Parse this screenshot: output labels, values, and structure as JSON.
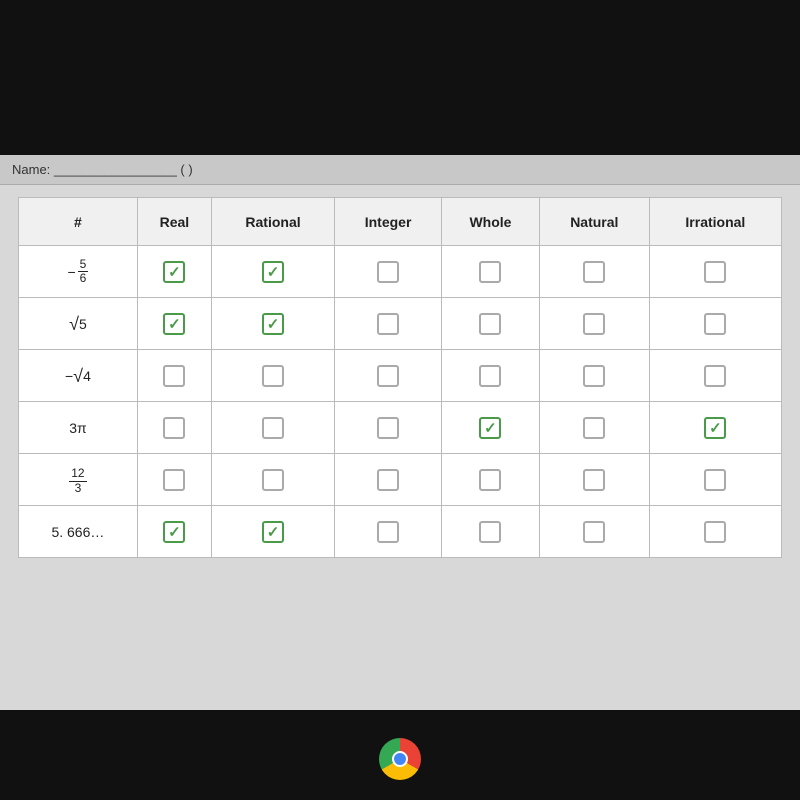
{
  "header": {
    "title": "Name: _________________ (  )"
  },
  "table": {
    "columns": [
      "#",
      "Real",
      "Rational",
      "Integer",
      "Whole",
      "Natural",
      "Irrational"
    ],
    "rows": [
      {
        "number_display": "neg_frac_5_6",
        "label": "-5/6",
        "cells": [
          true,
          true,
          false,
          false,
          false,
          false
        ]
      },
      {
        "number_display": "sqrt_5",
        "label": "√5",
        "cells": [
          true,
          true,
          false,
          false,
          false,
          false
        ]
      },
      {
        "number_display": "neg_sqrt_4",
        "label": "-√4",
        "cells": [
          false,
          false,
          false,
          false,
          false,
          false
        ]
      },
      {
        "number_display": "3pi",
        "label": "3π",
        "cells": [
          false,
          false,
          false,
          true,
          false,
          true
        ]
      },
      {
        "number_display": "frac_12_3",
        "label": "12/3",
        "cells": [
          false,
          false,
          false,
          false,
          false,
          false
        ]
      },
      {
        "number_display": "5_666",
        "label": "5.666...",
        "cells": [
          true,
          true,
          false,
          false,
          false,
          false
        ]
      }
    ]
  },
  "chrome": {
    "label": "Chrome"
  }
}
